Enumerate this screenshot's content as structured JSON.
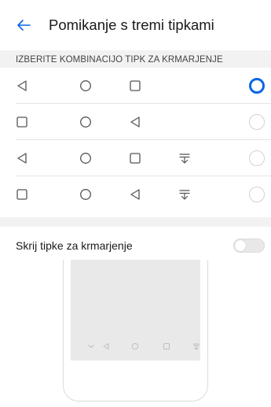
{
  "header": {
    "back_icon": "arrow-left-icon",
    "title": "Pomikanje s tremi tipkami"
  },
  "section": {
    "label": "IZBERITE KOMBINACIJO TIPK ZA KRMARJENJE"
  },
  "combinations": [
    {
      "keys": [
        "back-icon",
        "home-icon",
        "recents-icon"
      ],
      "selected": true
    },
    {
      "keys": [
        "recents-icon",
        "home-icon",
        "back-icon"
      ],
      "selected": false
    },
    {
      "keys": [
        "back-icon",
        "home-icon",
        "recents-icon",
        "notification-pull-icon"
      ],
      "selected": false
    },
    {
      "keys": [
        "recents-icon",
        "home-icon",
        "back-icon",
        "notification-pull-icon"
      ],
      "selected": false
    }
  ],
  "hide_keys": {
    "label": "Skrij tipke za krmarjenje",
    "enabled": false
  },
  "preview": {
    "keys": [
      "chevron-down-icon",
      "back-icon",
      "home-icon",
      "recents-icon",
      "notification-pull-icon"
    ]
  },
  "colors": {
    "accent": "#0a66e6",
    "icon": "#555555",
    "preview_icon": "#bdbdbd",
    "section_bg": "#f2f2f2"
  }
}
